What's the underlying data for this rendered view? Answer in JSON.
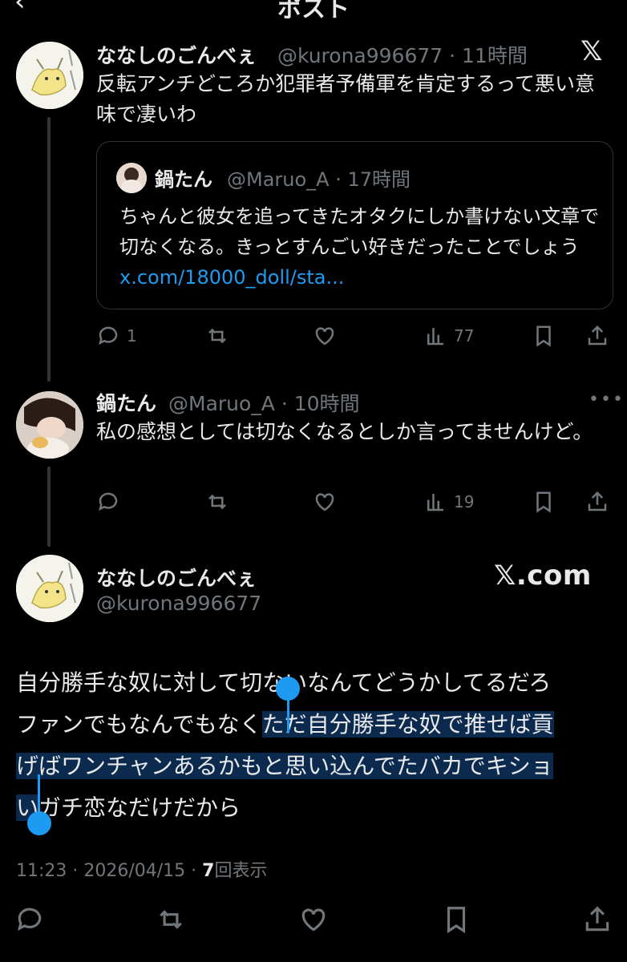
{
  "header": {
    "back_icon": "chevron-left-icon",
    "title": "ポスト"
  },
  "reply1": {
    "author": "ななしのごんべぇ",
    "handle_time": "@kurona996677 · 11時間",
    "text": "反転アンチどころか犯罪者予備軍を肯定するって悪い意味で凄いわ",
    "quote": {
      "author": "鍋たん",
      "handle_time": "@Maruo_A · 17時間",
      "text": "ちゃんと彼女を追ってきたオタクにしか書けない文章で切なくなる。きっとすんごい好きだったことでしょう ",
      "link": "x.com/18000_doll/sta..."
    },
    "stats": {
      "replies": "1",
      "views": "77"
    }
  },
  "reply2": {
    "author": "鍋たん",
    "handle_time": "@Maruo_A · 10時間",
    "text": "私の感想としては切なくなるとしか言ってませんけど。",
    "stats": {
      "views": "19"
    }
  },
  "main": {
    "author": "ななしのごんべぇ",
    "handle": "@kurona996677",
    "source": "𝕏.com",
    "lines": [
      {
        "plain": "自分勝手な奴に対して切ないなんてどうかしてるだろ",
        "selected": ""
      },
      {
        "plain": "ファンでもなんでもなく",
        "selected": "ただ自分勝手な奴で推せば貢"
      },
      {
        "plain": "",
        "selected": "げばワンチャンあるかもと思い込んでたバカでキショ"
      },
      {
        "plain_after": "ガチ恋なだけだから",
        "selected": "い"
      }
    ],
    "time": "11:23 · 2026/04/15 · ",
    "views_count": "7",
    "views_label": "回表示"
  },
  "colors": {
    "accent": "#1d9bf0",
    "selection": "#0b2a4d",
    "muted": "#71767b"
  }
}
